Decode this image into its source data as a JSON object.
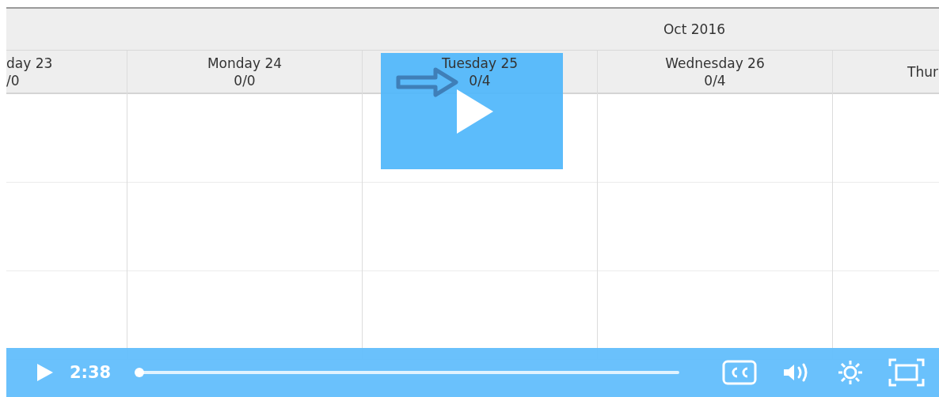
{
  "calendar": {
    "month": "Oct 2016",
    "days": [
      {
        "name": "day 23",
        "count": "/0"
      },
      {
        "name": "Monday 24",
        "count": "0/0"
      },
      {
        "name": "Tuesday 25",
        "count": "0/4"
      },
      {
        "name": "Wednesday 26",
        "count": "0/4"
      },
      {
        "name": "Thur"
      }
    ]
  },
  "player": {
    "time": "2:38",
    "progress": {
      "level": 0
    }
  }
}
